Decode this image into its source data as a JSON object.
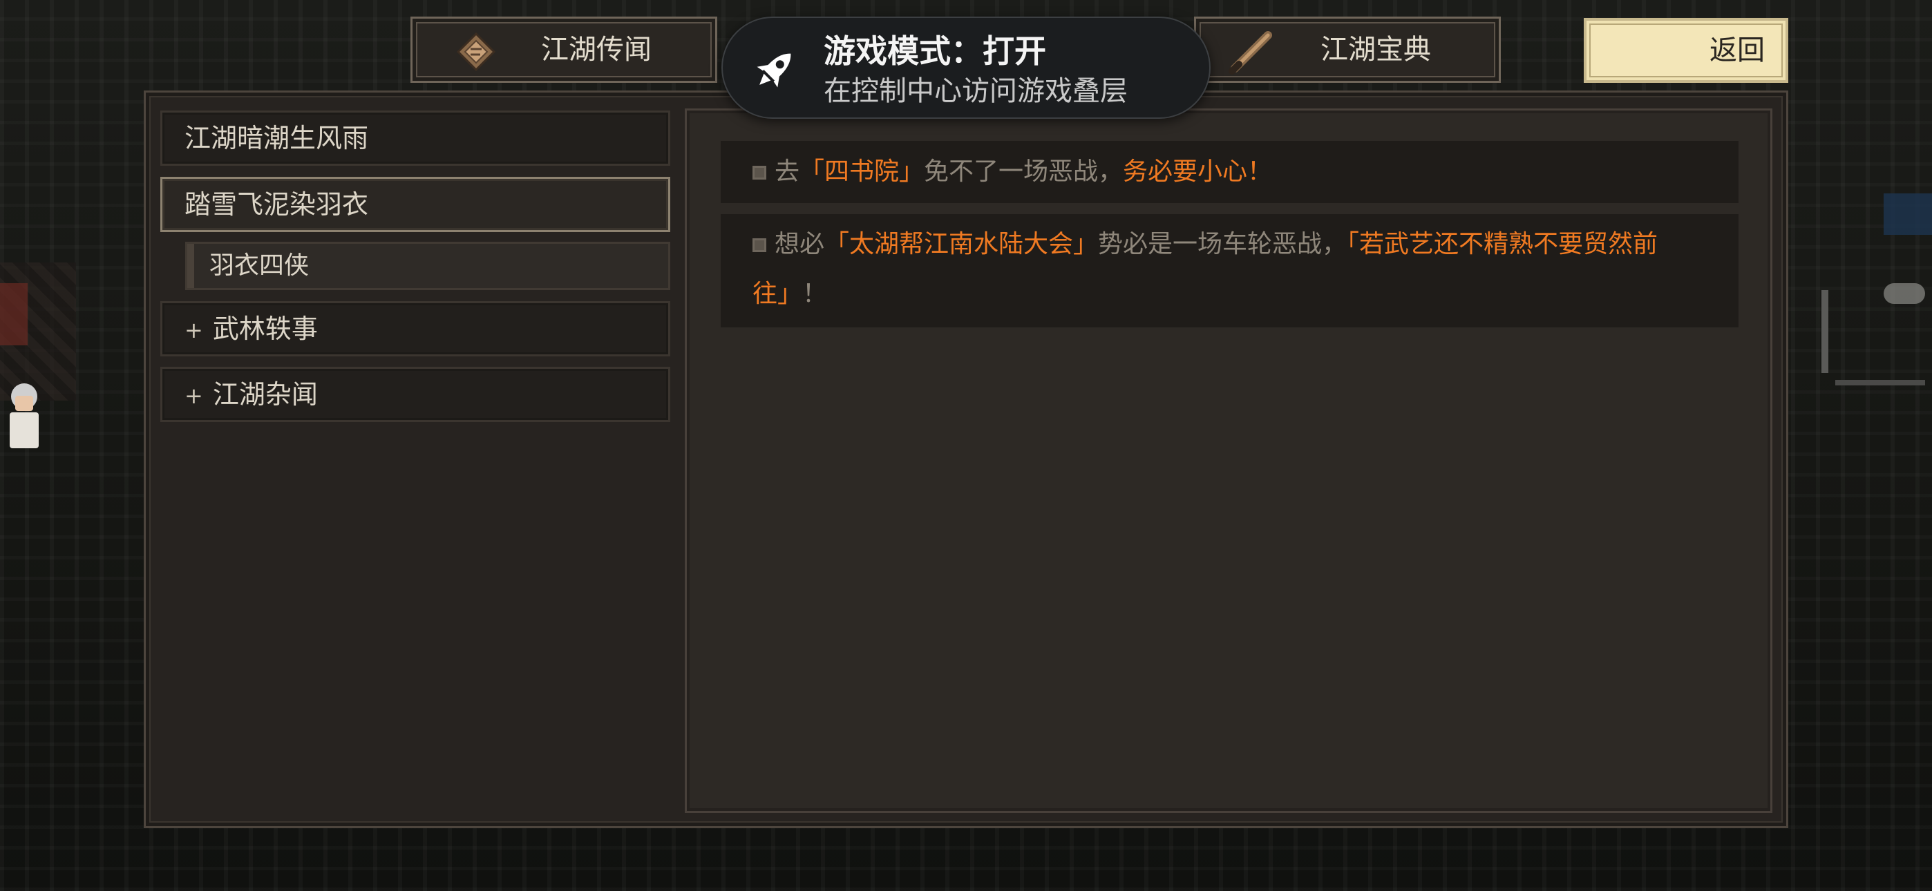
{
  "top_tabs": {
    "left_tab": {
      "label": "江湖传闻",
      "icon": "scroll-icon"
    },
    "right_tab": {
      "label": "江湖宝典",
      "icon": "brush-icon"
    }
  },
  "back_button": {
    "label": "返回"
  },
  "overlay": {
    "title": "游戏模式：打开",
    "subtitle": "在控制中心访问游戏叠层",
    "icon": "rocket-icon"
  },
  "sidebar": {
    "items": [
      {
        "label": "江湖暗潮生风雨"
      },
      {
        "label": "踏雪飞泥染羽衣",
        "selected": true
      },
      {
        "label": "羽衣四侠",
        "sub": true
      },
      {
        "label": "武林轶事",
        "collapsed": true,
        "prefix": "+"
      },
      {
        "label": "江湖杂闻",
        "collapsed": true,
        "prefix": "+"
      }
    ]
  },
  "entries": [
    {
      "parts": [
        {
          "text": "去",
          "hl": false
        },
        {
          "text": "「四书院」",
          "hl": true
        },
        {
          "text": "免不了一场恶战，",
          "hl": false
        },
        {
          "text": "务必要小心！",
          "hl": true
        }
      ]
    },
    {
      "parts": [
        {
          "text": "想必",
          "hl": false
        },
        {
          "text": "「太湖帮江南水陆大会」",
          "hl": true
        },
        {
          "text": "势必是一场车轮恶战，",
          "hl": false
        },
        {
          "text": "「若武艺还不精熟不要贸然前往」",
          "hl": true
        },
        {
          "text": "！",
          "hl": false
        }
      ]
    }
  ],
  "colors": {
    "highlight": "#f07a22",
    "body_text": "#8f877b",
    "back_button_bg": "#f3e6b8"
  }
}
